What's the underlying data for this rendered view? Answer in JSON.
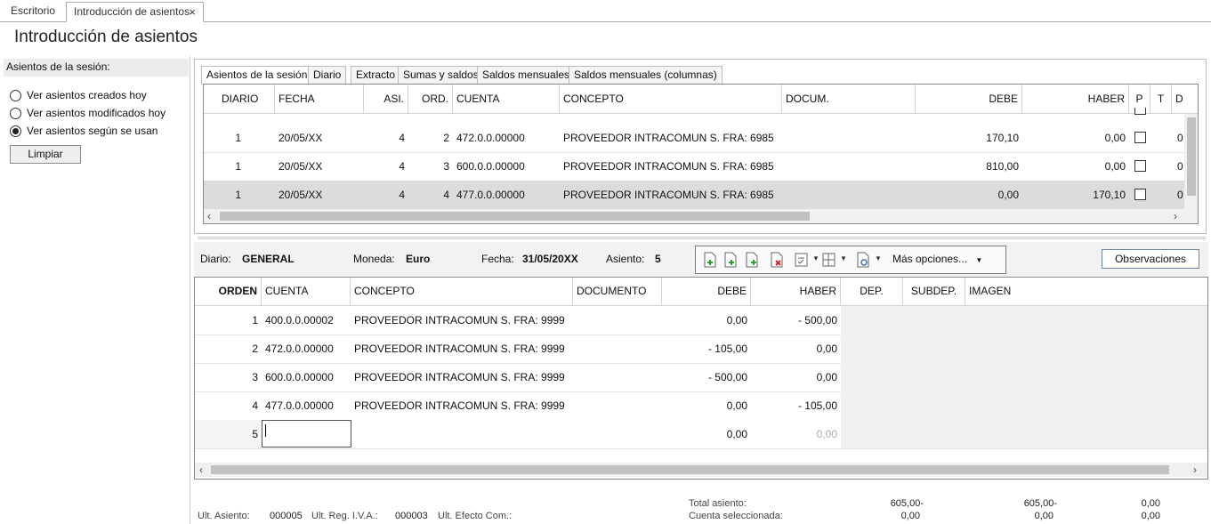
{
  "top_tabs": [
    {
      "label": "Escritorio"
    },
    {
      "label": "Introducción de asientos",
      "close": "×"
    }
  ],
  "page_title": "Introducción de asientos",
  "left": {
    "heading": "Asientos de la sesión:",
    "options": [
      {
        "label": "Ver asientos creados hoy",
        "selected": false
      },
      {
        "label": "Ver asientos modificados hoy",
        "selected": false
      },
      {
        "label": "Ver asientos según se usan",
        "selected": true
      }
    ],
    "clear_button": "Limpiar"
  },
  "session": {
    "tabs": [
      "Asientos de la sesión",
      "Diario",
      "Extracto",
      "Sumas y saldos",
      "Saldos mensuales",
      "Saldos mensuales (columnas)"
    ],
    "columns": [
      "DIARIO",
      "FECHA",
      "ASI.",
      "ORD.",
      "CUENTA",
      "CONCEPTO",
      "DOCUM.",
      "DEBE",
      "HABER",
      "P",
      "T",
      "D"
    ],
    "rows": [
      {
        "diario": "1",
        "fecha": "20/05/XX",
        "asi": "4",
        "ord": "2",
        "cuenta": "472.0.0.00000",
        "concepto": "PROVEEDOR INTRACOMUN S. FRA:  6985",
        "docum": "",
        "debe": "170,10",
        "haber": "0,00",
        "d": "0"
      },
      {
        "diario": "1",
        "fecha": "20/05/XX",
        "asi": "4",
        "ord": "3",
        "cuenta": "600.0.0.00000",
        "concepto": "PROVEEDOR INTRACOMUN S. FRA:  6985",
        "docum": "",
        "debe": "810,00",
        "haber": "0,00",
        "d": "0"
      },
      {
        "diario": "1",
        "fecha": "20/05/XX",
        "asi": "4",
        "ord": "4",
        "cuenta": "477.0.0.00000",
        "concepto": "PROVEEDOR INTRACOMUN S. FRA:  6985",
        "docum": "",
        "debe": "0,00",
        "haber": "170,10",
        "d": "0"
      }
    ]
  },
  "info": {
    "diario_label": "Diario:",
    "diario_value": "GENERAL",
    "moneda_label": "Moneda:",
    "moneda_value": "Euro",
    "fecha_label": "Fecha:",
    "fecha_value": "31/05/20XX",
    "asiento_label": "Asiento:",
    "asiento_value": "5",
    "more_options": "Más opciones...",
    "observaciones": "Observaciones",
    "toolbar_icons": [
      "new-line-icon",
      "insert-line-icon",
      "add-line-icon",
      "delete-line-icon",
      "check-list-icon",
      "copy-icon",
      "document-settings-icon"
    ]
  },
  "entry": {
    "columns": [
      "ORDEN",
      "CUENTA",
      "CONCEPTO",
      "DOCUMENTO",
      "DEBE",
      "HABER",
      "DEP.",
      "SUBDEP.",
      "IMAGEN"
    ],
    "rows": [
      {
        "orden": "1",
        "cuenta": "400.0.0.00002",
        "concepto": "PROVEEDOR INTRACOMUN S. FRA:  9999",
        "documento": "",
        "debe": "0,00",
        "haber": "- 500,00"
      },
      {
        "orden": "2",
        "cuenta": "472.0.0.00000",
        "concepto": "PROVEEDOR INTRACOMUN S. FRA:  9999",
        "documento": "",
        "debe": "- 105,00",
        "haber": "0,00"
      },
      {
        "orden": "3",
        "cuenta": "600.0.0.00000",
        "concepto": "PROVEEDOR INTRACOMUN S. FRA:  9999",
        "documento": "",
        "debe": "- 500,00",
        "haber": "0,00"
      },
      {
        "orden": "4",
        "cuenta": "477.0.0.00000",
        "concepto": "PROVEEDOR INTRACOMUN S. FRA:  9999",
        "documento": "",
        "debe": "0,00",
        "haber": "- 105,00"
      },
      {
        "orden": "5",
        "cuenta": "",
        "concepto": "",
        "documento": "",
        "debe": "0,00",
        "haber": "0,00"
      }
    ]
  },
  "footer": {
    "ult_asiento_label": "Ult. Asiento:",
    "ult_asiento": "000005",
    "ult_iva_label": "Ult. Reg. I.V.A.:",
    "ult_iva": "000003",
    "ult_efecto_label": "Ult. Efecto Com.:",
    "total_label": "Total asiento:",
    "cuenta_label": "Cuenta seleccionada:",
    "total_debe": "605,00-",
    "total_haber": "605,00-",
    "total_saldo": "0,00",
    "cuenta_debe": "0,00",
    "cuenta_haber": "0,00",
    "cuenta_saldo": "0,00"
  }
}
